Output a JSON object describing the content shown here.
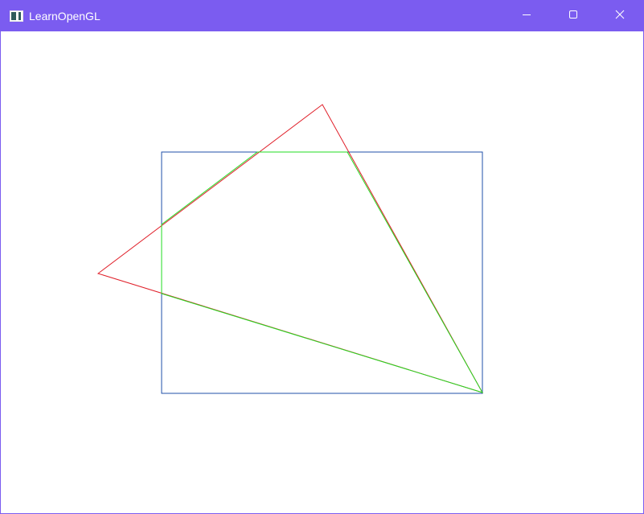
{
  "window": {
    "title": "LearnOpenGL",
    "controls": [
      {
        "name": "minimize",
        "icon": "minimize-icon"
      },
      {
        "name": "maximize",
        "icon": "maximize-icon"
      },
      {
        "name": "close",
        "icon": "close-icon"
      }
    ]
  },
  "colors": {
    "titlebar": "#7b5cf0",
    "viewport_background": "#ffffff",
    "rectangle_outline": "#1f4fa8",
    "triangle_red": "#e0202a",
    "triangle_green": "#22dd22"
  },
  "scene": {
    "rectangle": {
      "shape": "rectangle-outline",
      "color": "blue"
    },
    "triangle_rotated": {
      "shape": "triangle-outline",
      "color": "red"
    },
    "triangle_base": {
      "shape": "triangle-outline",
      "color": "green"
    }
  }
}
